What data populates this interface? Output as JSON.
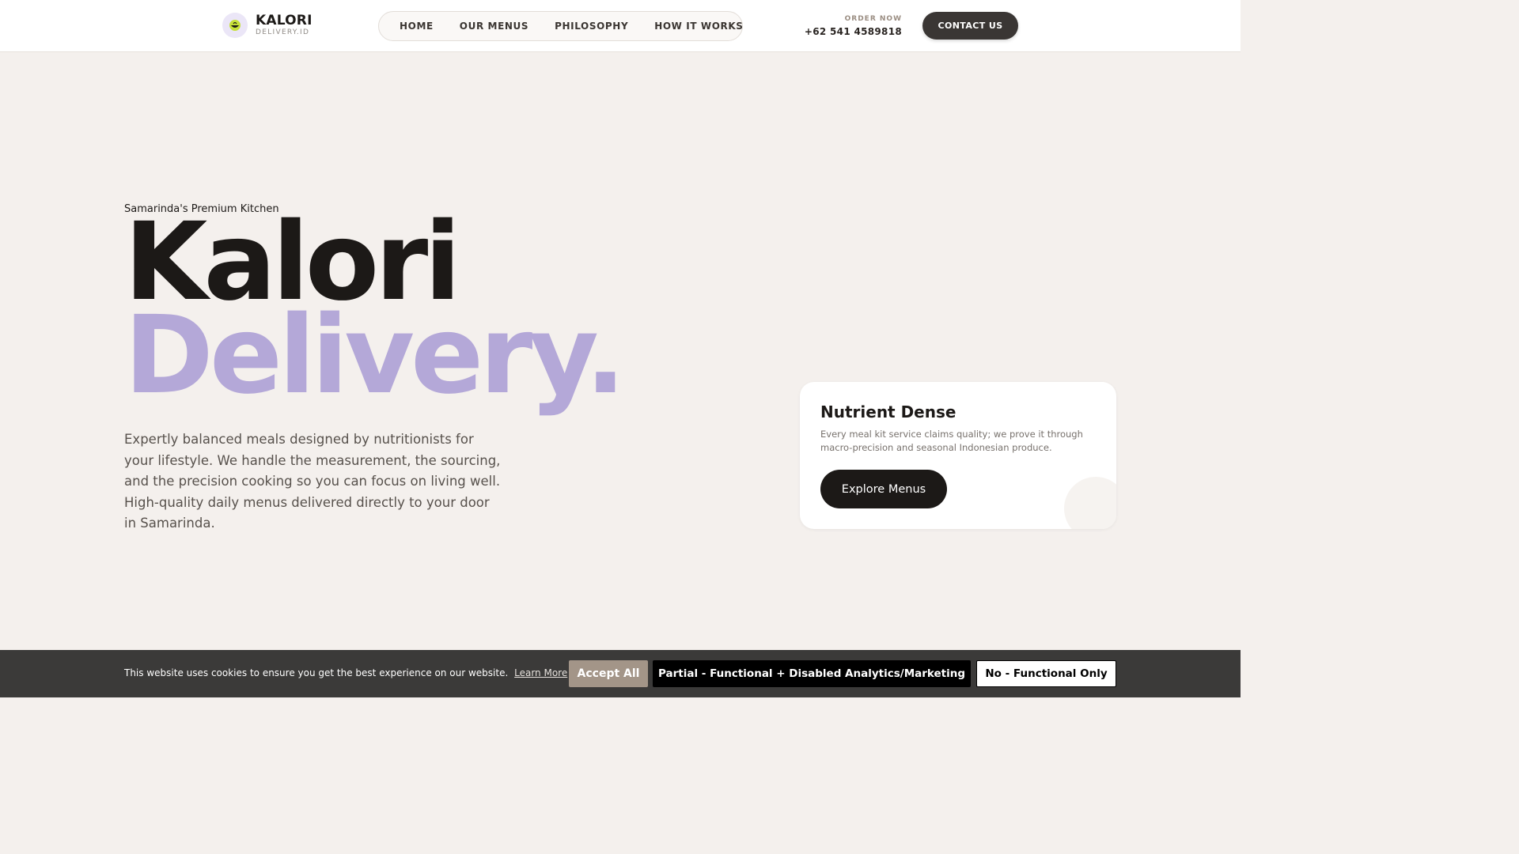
{
  "header": {
    "logo": {
      "title": "KALORI",
      "subtitle": "DELIVERY.ID",
      "icon": "leaf-bowl-icon",
      "badge_color": "#ebe6f7",
      "icon_color": "#c6e03a"
    },
    "nav": [
      {
        "label": "HOME"
      },
      {
        "label": "OUR MENUS"
      },
      {
        "label": "PHILOSOPHY"
      },
      {
        "label": "HOW IT WORKS"
      }
    ],
    "order": {
      "label": "ORDER NOW",
      "phone": "+62 541 4589818"
    },
    "contact_label": "CONTACT US"
  },
  "hero": {
    "eyebrow": "Samarinda's Premium Kitchen",
    "title_line1": "Kalori",
    "title_line2": "Delivery.",
    "accent_color": "#b4a8d8",
    "description": "Expertly balanced meals designed by nutritionists for your lifestyle. We handle the measurement, the sourcing, and the precision cooking so you can focus on living well. High-quality daily menus delivered directly to your door in Samarinda."
  },
  "card": {
    "title": "Nutrient Dense",
    "text": "Every meal kit service claims quality; we prove it through macro-precision and seasonal Indonesian produce.",
    "button_label": "Explore Menus"
  },
  "cookie": {
    "text": "This website uses cookies to ensure you get the best experience on our website.",
    "learn_more": "Learn More",
    "accept_all": "Accept All",
    "partial": "Partial - Functional + Disabled Analytics/Marketing",
    "functional_only": "No - Functional Only",
    "accept_color": "#a39588",
    "bar_color": "#3b3a39"
  }
}
